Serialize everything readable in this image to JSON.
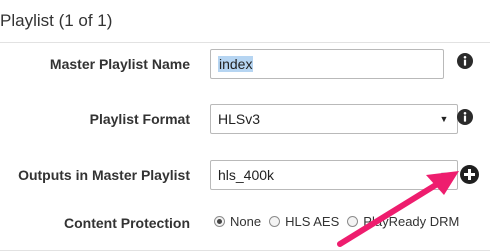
{
  "section": {
    "title": "Playlist (1 of 1)"
  },
  "fields": {
    "master_name": {
      "label": "Master Playlist Name",
      "value": "index"
    },
    "format": {
      "label": "Playlist Format",
      "value": "HLSv3"
    },
    "outputs": {
      "label": "Outputs in Master Playlist",
      "value": "hls_400k"
    },
    "protection": {
      "label": "Content Protection",
      "options": [
        "None",
        "HLS AES",
        "PlayReady DRM"
      ],
      "selected": "None"
    }
  },
  "colors": {
    "arrow": "#ee1d6e",
    "selection": "#b6d5f2"
  },
  "icons": [
    "info-icon",
    "plus-circle-icon",
    "chevron-down-icon"
  ]
}
